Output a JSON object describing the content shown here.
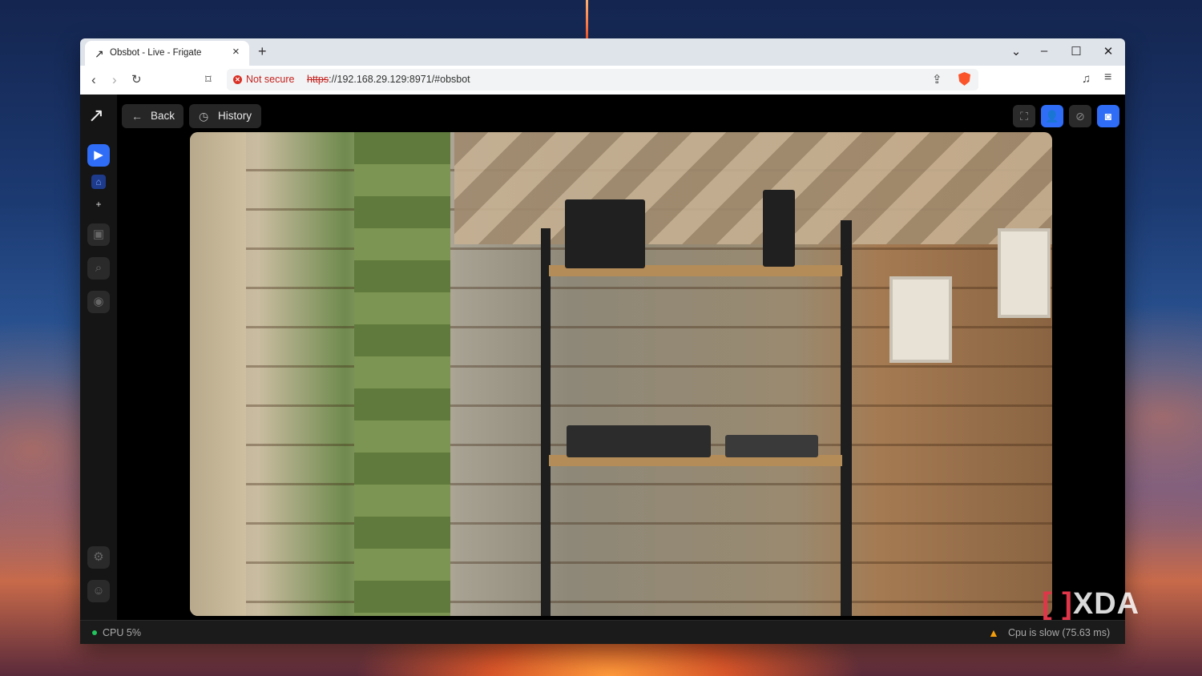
{
  "browser": {
    "tab_title": "Obsbot - Live - Frigate",
    "tab_favicon": "frigate-bird-icon",
    "new_tab": "+",
    "security_label": "Not secure",
    "url_scheme": "https",
    "url_rest": "://192.168.29.129:8971/#obsbot"
  },
  "toolbar": {
    "back_label": "Back",
    "history_label": "History"
  },
  "status": {
    "cpu": "CPU 5%",
    "warning": "Cpu is slow (75.63 ms)"
  },
  "watermark": {
    "brand": "XDA"
  },
  "colors": {
    "accent": "#2f6df6",
    "app_bg": "#000000",
    "sidebar_bg": "#151515",
    "status_ok": "#22c55e",
    "status_warn": "#f59e0b",
    "insecure": "#c5221f"
  }
}
